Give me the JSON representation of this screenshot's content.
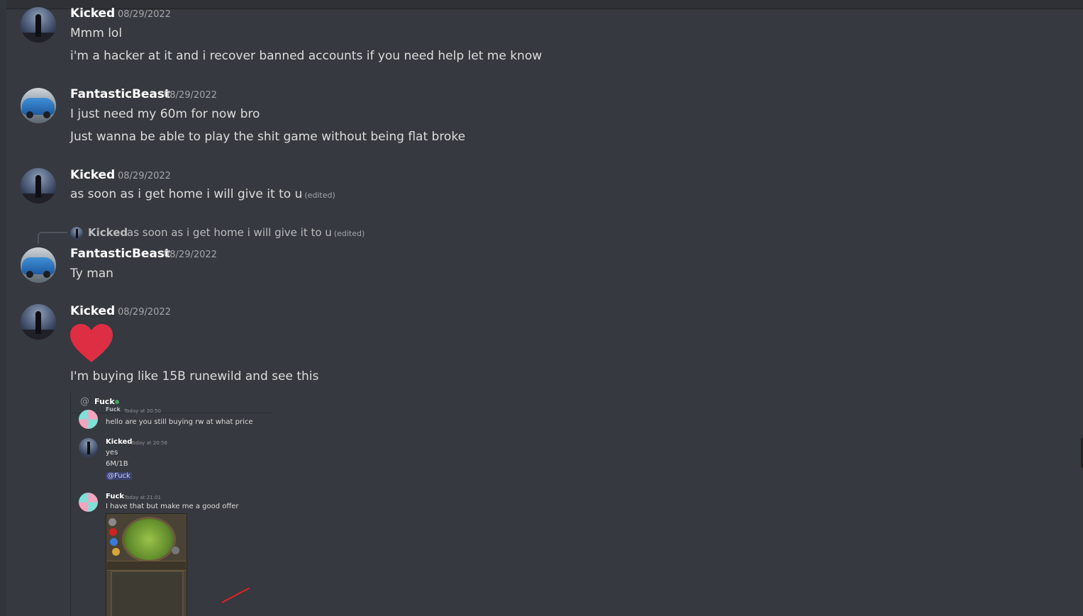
{
  "messages": [
    {
      "author": "Kicked",
      "timestamp": "08/29/2022",
      "lines": [
        "Mmm lol",
        "i'm a hacker at it and i recover banned accounts if you need help let me know"
      ]
    },
    {
      "author": "FantasticBeast",
      "timestamp": "08/29/2022",
      "lines": [
        "I just need my 60m for now bro",
        "Just wanna be able to play the shit game without being flat broke"
      ]
    },
    {
      "author": "Kicked",
      "timestamp": "08/29/2022",
      "lines": [
        "as soon as i get home i will give it to u"
      ],
      "edited": "(edited)"
    },
    {
      "reply": {
        "author": "Kicked",
        "text": "as soon as i get home i will give it to u",
        "edited": "(edited)"
      },
      "author": "FantasticBeast",
      "timestamp": "08/29/2022",
      "lines": [
        "Ty man"
      ]
    },
    {
      "author": "Kicked",
      "timestamp": "08/29/2022",
      "emoji": "heart-emoji",
      "lines": [
        "I'm buying like 15B runewild and see this"
      ]
    }
  ],
  "attachment": {
    "dm_name": "Fuck",
    "status_color": "#3ba55d",
    "messages": [
      {
        "author": "Fuck",
        "time": "Today at 20:50",
        "lines": [
          "hello are you still buying rw at what price"
        ]
      },
      {
        "author": "Kicked",
        "time": "Today at 20:56",
        "lines": [
          "yes",
          "6M/1B"
        ],
        "mention": "@Fuck"
      },
      {
        "author": "Fuck",
        "time": "Today at 21:01",
        "lines": [
          "I have that but make me a good offer"
        ]
      }
    ]
  },
  "colors": {
    "background": "#36393f",
    "username": "#ffffff",
    "text": "#dcddde",
    "muted": "#a3a6aa",
    "heart": "#dd2e44",
    "arrow": "#e0222b"
  }
}
